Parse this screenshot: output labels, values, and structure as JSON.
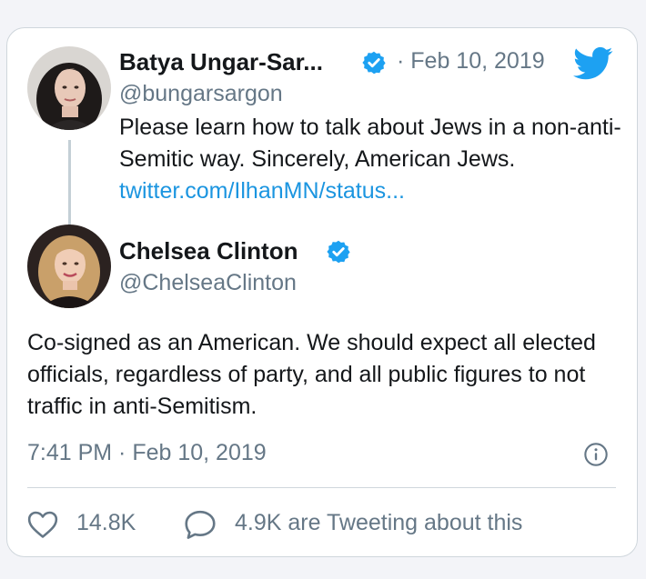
{
  "quoted_tweet": {
    "author_name": "Batya Ungar-Sar...",
    "verified_icon": "verified-badge-icon",
    "separator": "·",
    "date": "Feb 10, 2019",
    "handle": "@bungarsargon",
    "text": "Please learn how to talk about Jews in a non-anti-Semitic way. Sincerely, American Jews. ",
    "link": "twitter.com/IlhanMN/status..."
  },
  "main_tweet": {
    "author_name": "Chelsea Clinton",
    "verified_icon": "verified-badge-icon",
    "handle": "@ChelseaClinton",
    "text": "Co-signed as an American. We should expect all elected officials, regardless of party, and all public figures to not traffic in anti-Semitism.",
    "timestamp": "7:41 PM · Feb 10, 2019"
  },
  "actions": {
    "likes": "14.8K",
    "replies_text": "4.9K are Tweeting about this"
  },
  "icons": {
    "brand": "twitter-bird-icon",
    "info": "info-icon",
    "like": "heart-icon",
    "reply": "comment-icon"
  },
  "colors": {
    "accent": "#1da1f2",
    "link": "#1b95e0",
    "muted": "#657786",
    "text": "#14171a"
  }
}
